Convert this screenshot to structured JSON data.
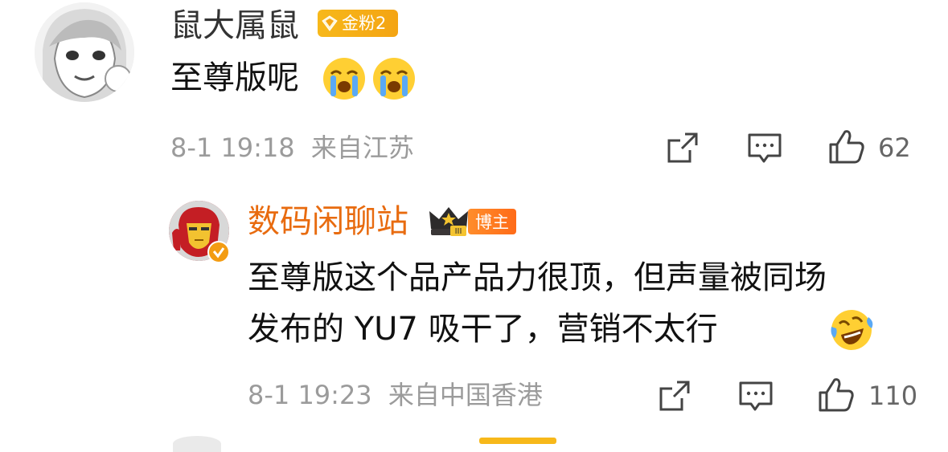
{
  "comments": [
    {
      "username": "鼠大属鼠",
      "fan_badge": "金粉2",
      "text": "至尊版呢",
      "emojis": [
        "crying-emoji",
        "crying-emoji"
      ],
      "time": "8-1 19:18",
      "location": "来自江苏",
      "likes": "62",
      "avatar": "anime-girl-avatar"
    }
  ],
  "replies": [
    {
      "username": "数码闲聊站",
      "rank_badge": "crown-badge",
      "host_badge": "博主",
      "text_line1": "至尊版这个品产品力很顶，但声量被同场",
      "text_line2": "发布的 YU7 吸干了，营销不太行",
      "emoji": "laughing-tears-emoji",
      "time": "8-1 19:23",
      "location": "来自中国香港",
      "likes": "110",
      "avatar": "iron-man-avatar",
      "verified": true
    }
  ],
  "icons": {
    "share": "share-icon",
    "comment": "comment-icon",
    "like": "thumbs-up-icon"
  },
  "colors": {
    "blogger_name": "#e86b0f",
    "meta_gray": "#9b9b9b",
    "fan_badge": "#f4a413",
    "host_badge": "#ff6b18"
  }
}
